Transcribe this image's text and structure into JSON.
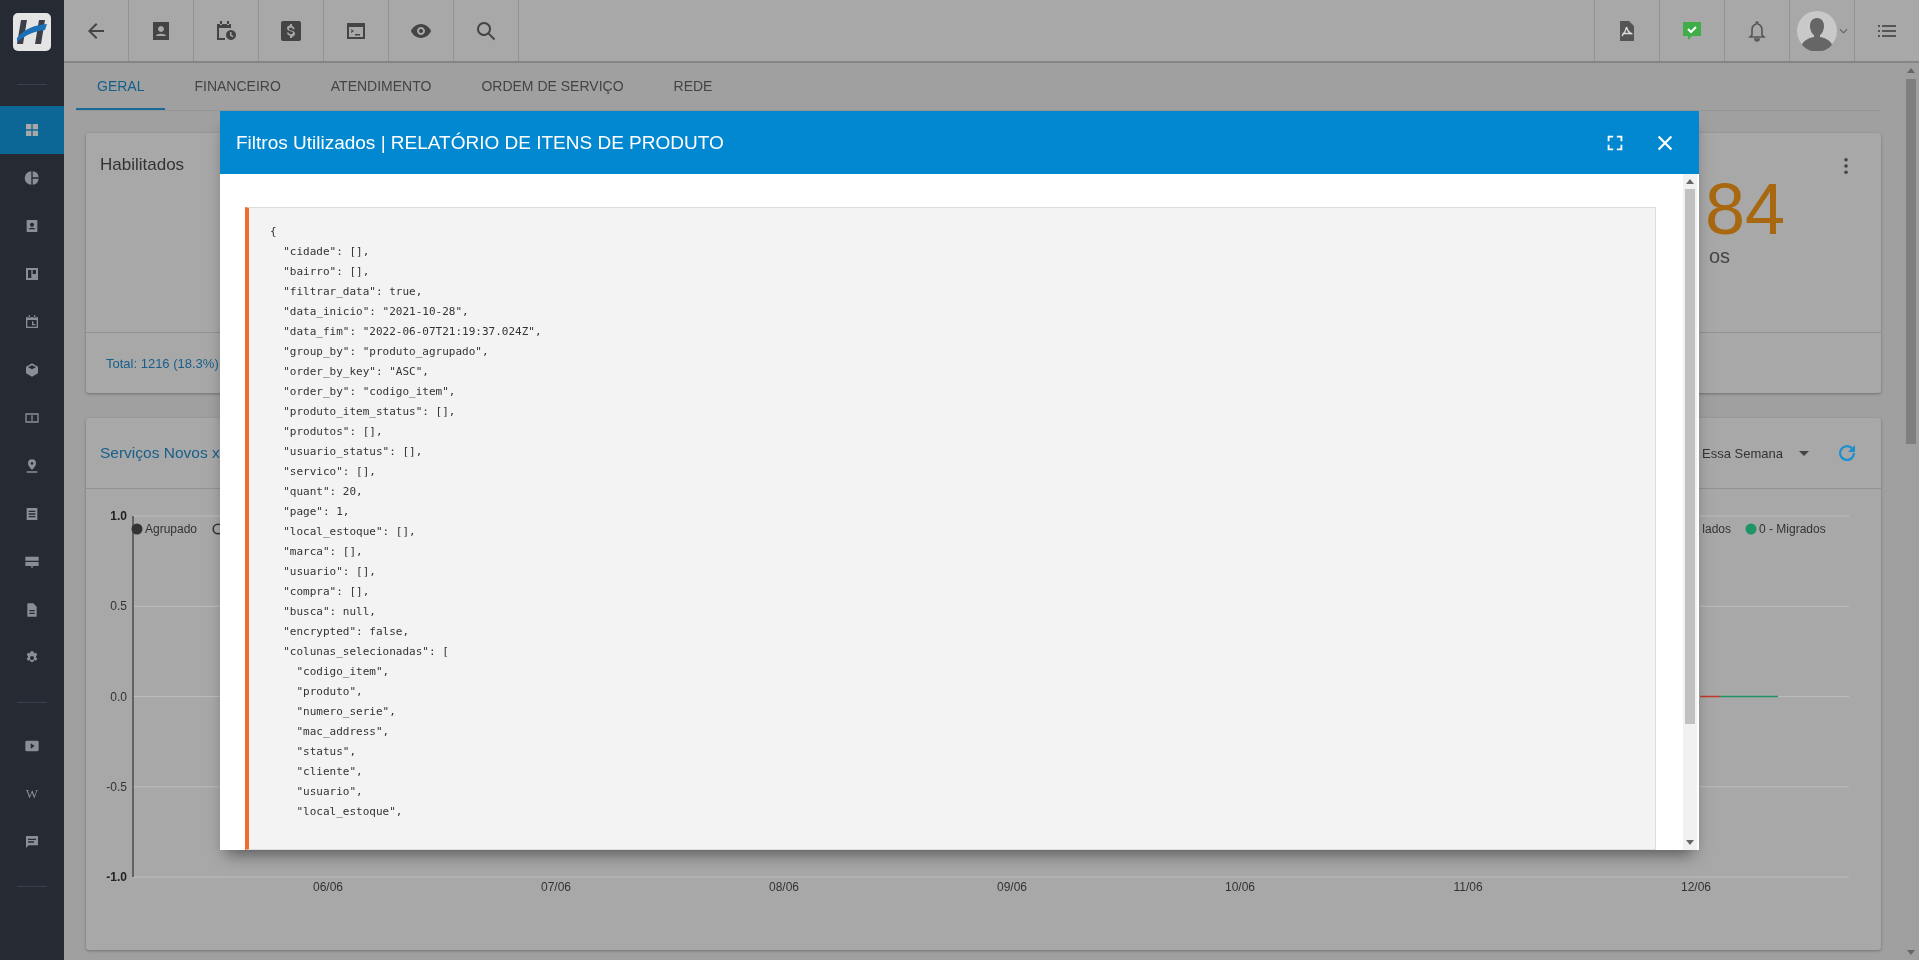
{
  "sidebar": {
    "items": [
      {
        "selected": true
      },
      {
        "selected": false
      },
      {
        "selected": false
      },
      {
        "selected": false
      },
      {
        "selected": false
      },
      {
        "selected": false
      },
      {
        "selected": false
      },
      {
        "selected": false
      },
      {
        "selected": false
      },
      {
        "selected": false
      },
      {
        "selected": false
      },
      {
        "selected": false
      }
    ],
    "secondary_items": [
      {
        "selected": false
      },
      {
        "selected": false,
        "glyph": "W"
      },
      {
        "selected": false
      }
    ]
  },
  "tabs": [
    {
      "label": "GERAL",
      "selected": true
    },
    {
      "label": "FINANCEIRO",
      "selected": false
    },
    {
      "label": "ATENDIMENTO",
      "selected": false
    },
    {
      "label": "ORDEM DE SERVIÇO",
      "selected": false
    },
    {
      "label": "REDE",
      "selected": false
    }
  ],
  "status_card": {
    "title": "Habilitados",
    "secondary_value": "84",
    "secondary_caption": "os",
    "total": "Total: 1216 (18.3%)"
  },
  "services_card": {
    "title": "Serviços Novos x",
    "period": "Essa Semana",
    "chart": {
      "y_ticks": [
        "1.0",
        "0.5",
        "0.0",
        "-0.5",
        "-1.0"
      ],
      "x_labels": [
        "06/06",
        "07/06",
        "08/06",
        "09/06",
        "10/06",
        "11/06",
        "12/06"
      ],
      "legend": [
        {
          "kind": "dot",
          "label": "Agrupado",
          "color": "#333333"
        },
        {
          "kind": "ring",
          "color": "#333333"
        },
        {
          "kind": "text",
          "label": "lados"
        },
        {
          "kind": "dot",
          "label": "0 - Migrados",
          "color": "#1f9466"
        }
      ]
    }
  },
  "modal": {
    "title": "Filtros Utilizados | RELATÓRIO DE ITENS DE PRODUTO",
    "code_lines": [
      "{",
      "  \"cidade\": [],",
      "  \"bairro\": [],",
      "  \"filtrar_data\": true,",
      "  \"data_inicio\": \"2021-10-28\",",
      "  \"data_fim\": \"2022-06-07T21:19:37.024Z\",",
      "  \"group_by\": \"produto_agrupado\",",
      "  \"order_by_key\": \"ASC\",",
      "  \"order_by\": \"codigo_item\",",
      "  \"produto_item_status\": [],",
      "  \"produtos\": [],",
      "  \"usuario_status\": [],",
      "  \"servico\": [],",
      "  \"quant\": 20,",
      "  \"page\": 1,",
      "  \"local_estoque\": [],",
      "  \"marca\": [],",
      "  \"usuario\": [],",
      "  \"compra\": [],",
      "  \"busca\": null,",
      "  \"encrypted\": false,",
      "  \"colunas_selecionadas\": [",
      "    \"codigo_item\",",
      "    \"produto\",",
      "    \"numero_serie\",",
      "    \"mac_address\",",
      "    \"status\",",
      "    \"cliente\",",
      "    \"usuario\",",
      "    \"local_estoque\","
    ]
  }
}
